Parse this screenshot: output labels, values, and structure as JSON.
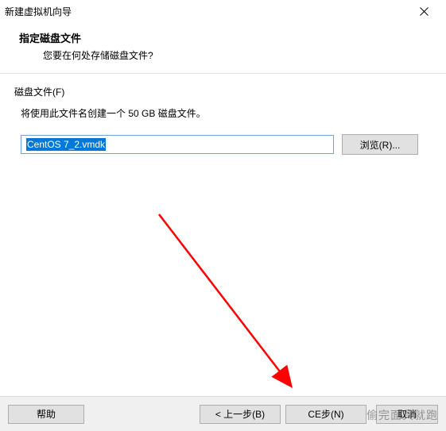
{
  "window": {
    "title": "新建虚拟机向导"
  },
  "header": {
    "title": "指定磁盘文件",
    "subtitle": "您要在何处存储磁盘文件?"
  },
  "content": {
    "fieldsetLabel": "磁盘文件(F)",
    "description": "将使用此文件名创建一个 50 GB 磁盘文件。",
    "fileValue": "CentOS 7_2.vmdk",
    "browseLabel": "浏览(R)..."
  },
  "footer": {
    "help": "帮助",
    "back": "< 上一步(B)",
    "next": "下一步(N) >",
    "nextOverlay": "CE步(N)",
    "cancel": "取消"
  },
  "watermark": "偷完面具就跑"
}
